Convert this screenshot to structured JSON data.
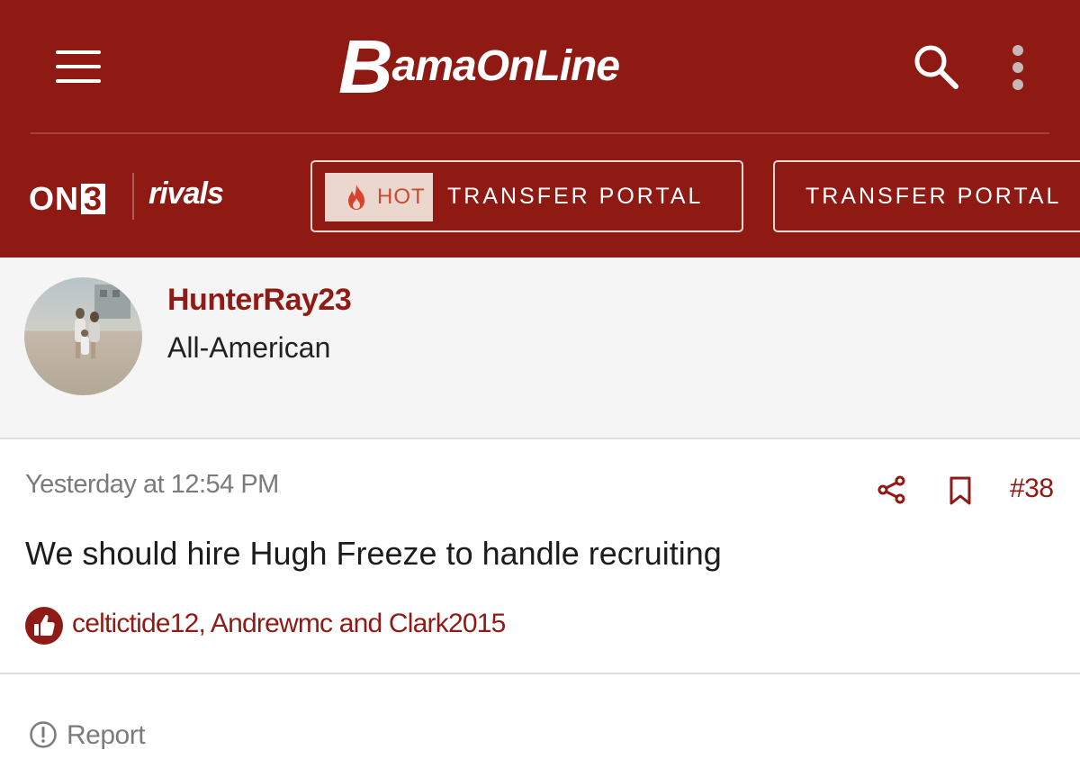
{
  "colors": {
    "brand": "#8f1a13",
    "brand_text": "#8e1b15",
    "hot_badge_bg": "#ecd7cf",
    "hot_badge_text": "#c94a33",
    "author_bg": "#f5f5f5"
  },
  "header": {
    "brand_logo": "BamaOnLine",
    "brand_first": "B",
    "brand_rest": "amaOnLine",
    "menu_icon": "hamburger-menu-icon",
    "search_icon": "search-icon",
    "more_icon": "more-vertical-icon"
  },
  "subnav": {
    "on3_prefix": "ON",
    "on3_suffix": "3",
    "rivals": "rivals",
    "pills": [
      {
        "badge": "HOT",
        "badge_icon": "flame-icon",
        "label": "TRANSFER PORTAL"
      },
      {
        "label": "TRANSFER PORTAL"
      }
    ]
  },
  "post": {
    "author": {
      "username": "HunterRay23",
      "title": "All-American",
      "avatar": "avatar-photo"
    },
    "timestamp": "Yesterday at 12:54 PM",
    "actions": {
      "share_icon": "share-icon",
      "bookmark_icon": "bookmark-icon"
    },
    "number": "#38",
    "message": "We should hire Hugh Freeze to handle recruiting",
    "reactions": {
      "icon": "thumbs-up-icon",
      "text": "celtictide12, Andrewmc and Clark2015"
    },
    "report": {
      "icon": "alert-circle-icon",
      "label": "Report"
    }
  }
}
